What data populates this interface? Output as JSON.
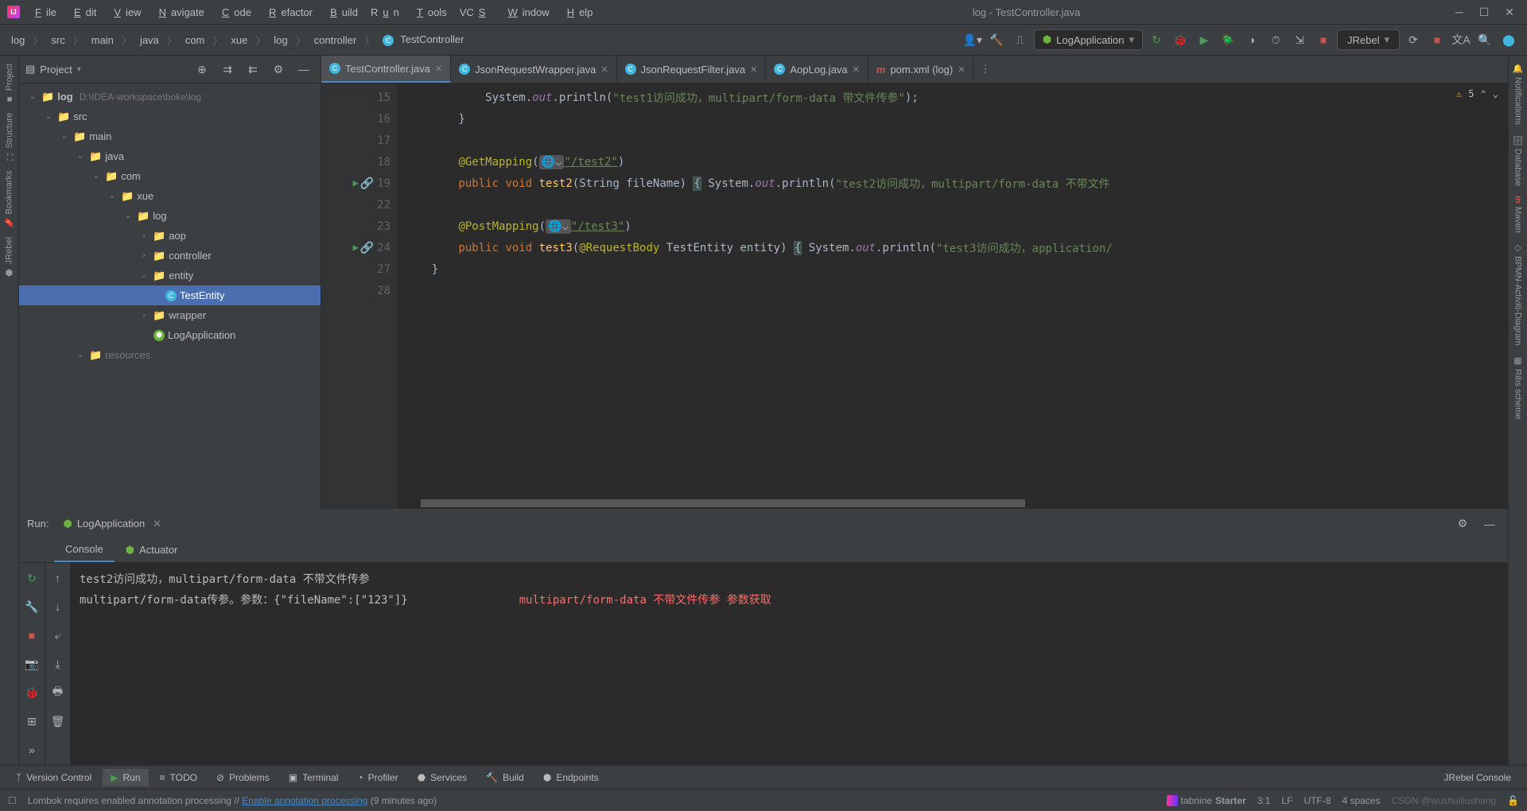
{
  "window": {
    "title": "log - TestController.java"
  },
  "menu": [
    "File",
    "Edit",
    "View",
    "Navigate",
    "Code",
    "Refactor",
    "Build",
    "Run",
    "Tools",
    "VCS",
    "Window",
    "Help"
  ],
  "breadcrumb": [
    "log",
    "src",
    "main",
    "java",
    "com",
    "xue",
    "log",
    "controller"
  ],
  "breadcrumb_class": "TestController",
  "run_config": "LogApplication",
  "jrebel": "JRebel",
  "project_panel": {
    "title": "Project"
  },
  "tree": {
    "root": {
      "name": "log",
      "path": "D:\\IDEA-workspace\\boke\\log"
    },
    "src": "src",
    "main": "main",
    "java": "java",
    "com": "com",
    "xue": "xue",
    "log_pkg": "log",
    "aop": "aop",
    "controller": "controller",
    "entity": "entity",
    "testentity": "TestEntity",
    "wrapper": "wrapper",
    "logapp": "LogApplication",
    "resources": "resources"
  },
  "editor_tabs": [
    {
      "name": "TestController.java",
      "type": "cls"
    },
    {
      "name": "JsonRequestWrapper.java",
      "type": "cls"
    },
    {
      "name": "JsonRequestFilter.java",
      "type": "cls"
    },
    {
      "name": "AopLog.java",
      "type": "cls"
    },
    {
      "name": "pom.xml (log)",
      "type": "mvn"
    }
  ],
  "inspection": {
    "warnings": "5"
  },
  "gutter_lines": [
    "15",
    "16",
    "17",
    "18",
    "19",
    "22",
    "23",
    "24",
    "27",
    "28"
  ],
  "code": {
    "l15": {
      "pre": "            System.",
      "out": "out",
      "mid": ".println(",
      "str": "\"test1访问成功，multipart/form-data 带文件传参\"",
      "end": ");"
    },
    "l16": "        }",
    "l18": {
      "ann": "@GetMapping",
      "open": "(",
      "globe": "🌐",
      "dd": "⌵",
      "str": "\"/test2\"",
      "close": ")"
    },
    "l19": {
      "pre": "        ",
      "pub": "public ",
      "void": "void ",
      "name": "test2",
      "sig": "(String fileName) ",
      "br": "{",
      "sys": " System.",
      "out": "out",
      "mid": ".println(",
      "str": "\"test2访问成功，multipart/form-data 不带文件",
      "end": ""
    },
    "l23": {
      "ann": "@PostMapping",
      "open": "(",
      "globe": "🌐",
      "dd": "⌵",
      "str": "\"/test3\"",
      "close": ")"
    },
    "l24": {
      "pre": "        ",
      "pub": "public ",
      "void": "void ",
      "name": "test3",
      "sig": "(",
      "rb": "@RequestBody",
      "sig2": " TestEntity entity) ",
      "br": "{",
      "sys": " System.",
      "out": "out",
      "mid": ".println(",
      "str": "\"test3访问成功，application/",
      "end": ""
    },
    "l27": "    }"
  },
  "run": {
    "label": "Run:",
    "config": "LogApplication",
    "tab_console": "Console",
    "tab_actuator": "Actuator",
    "line1": "test2访问成功，multipart/form-data 不带文件传参",
    "line2": "multipart/form-data传参。参数：{\"fileName\":[\"123\"]}",
    "annotation": "multipart/form-data 不带文件传参 参数获取"
  },
  "bottom": {
    "version_control": "Version Control",
    "run": "Run",
    "todo": "TODO",
    "problems": "Problems",
    "terminal": "Terminal",
    "profiler": "Profiler",
    "services": "Services",
    "build": "Build",
    "endpoints": "Endpoints",
    "jrebel": "JRebel Console"
  },
  "status": {
    "msg": "Lombok requires enabled annotation processing",
    "link": "Enable annotation processing",
    "time": "(9 minutes ago)",
    "tabnine": "tabnine",
    "starter": "Starter",
    "pos": "3:1",
    "lf": "LF",
    "enc": "UTF-8",
    "indent": "4 spaces",
    "watermark": "CSDN @wushuiliushang"
  },
  "left_tools": [
    "Project",
    "Structure",
    "Bookmarks",
    "JRebel"
  ],
  "right_tools": [
    "Notifications",
    "Database",
    "Maven",
    "BPMN-Activiti-Diagram",
    "Ribs scheme"
  ]
}
